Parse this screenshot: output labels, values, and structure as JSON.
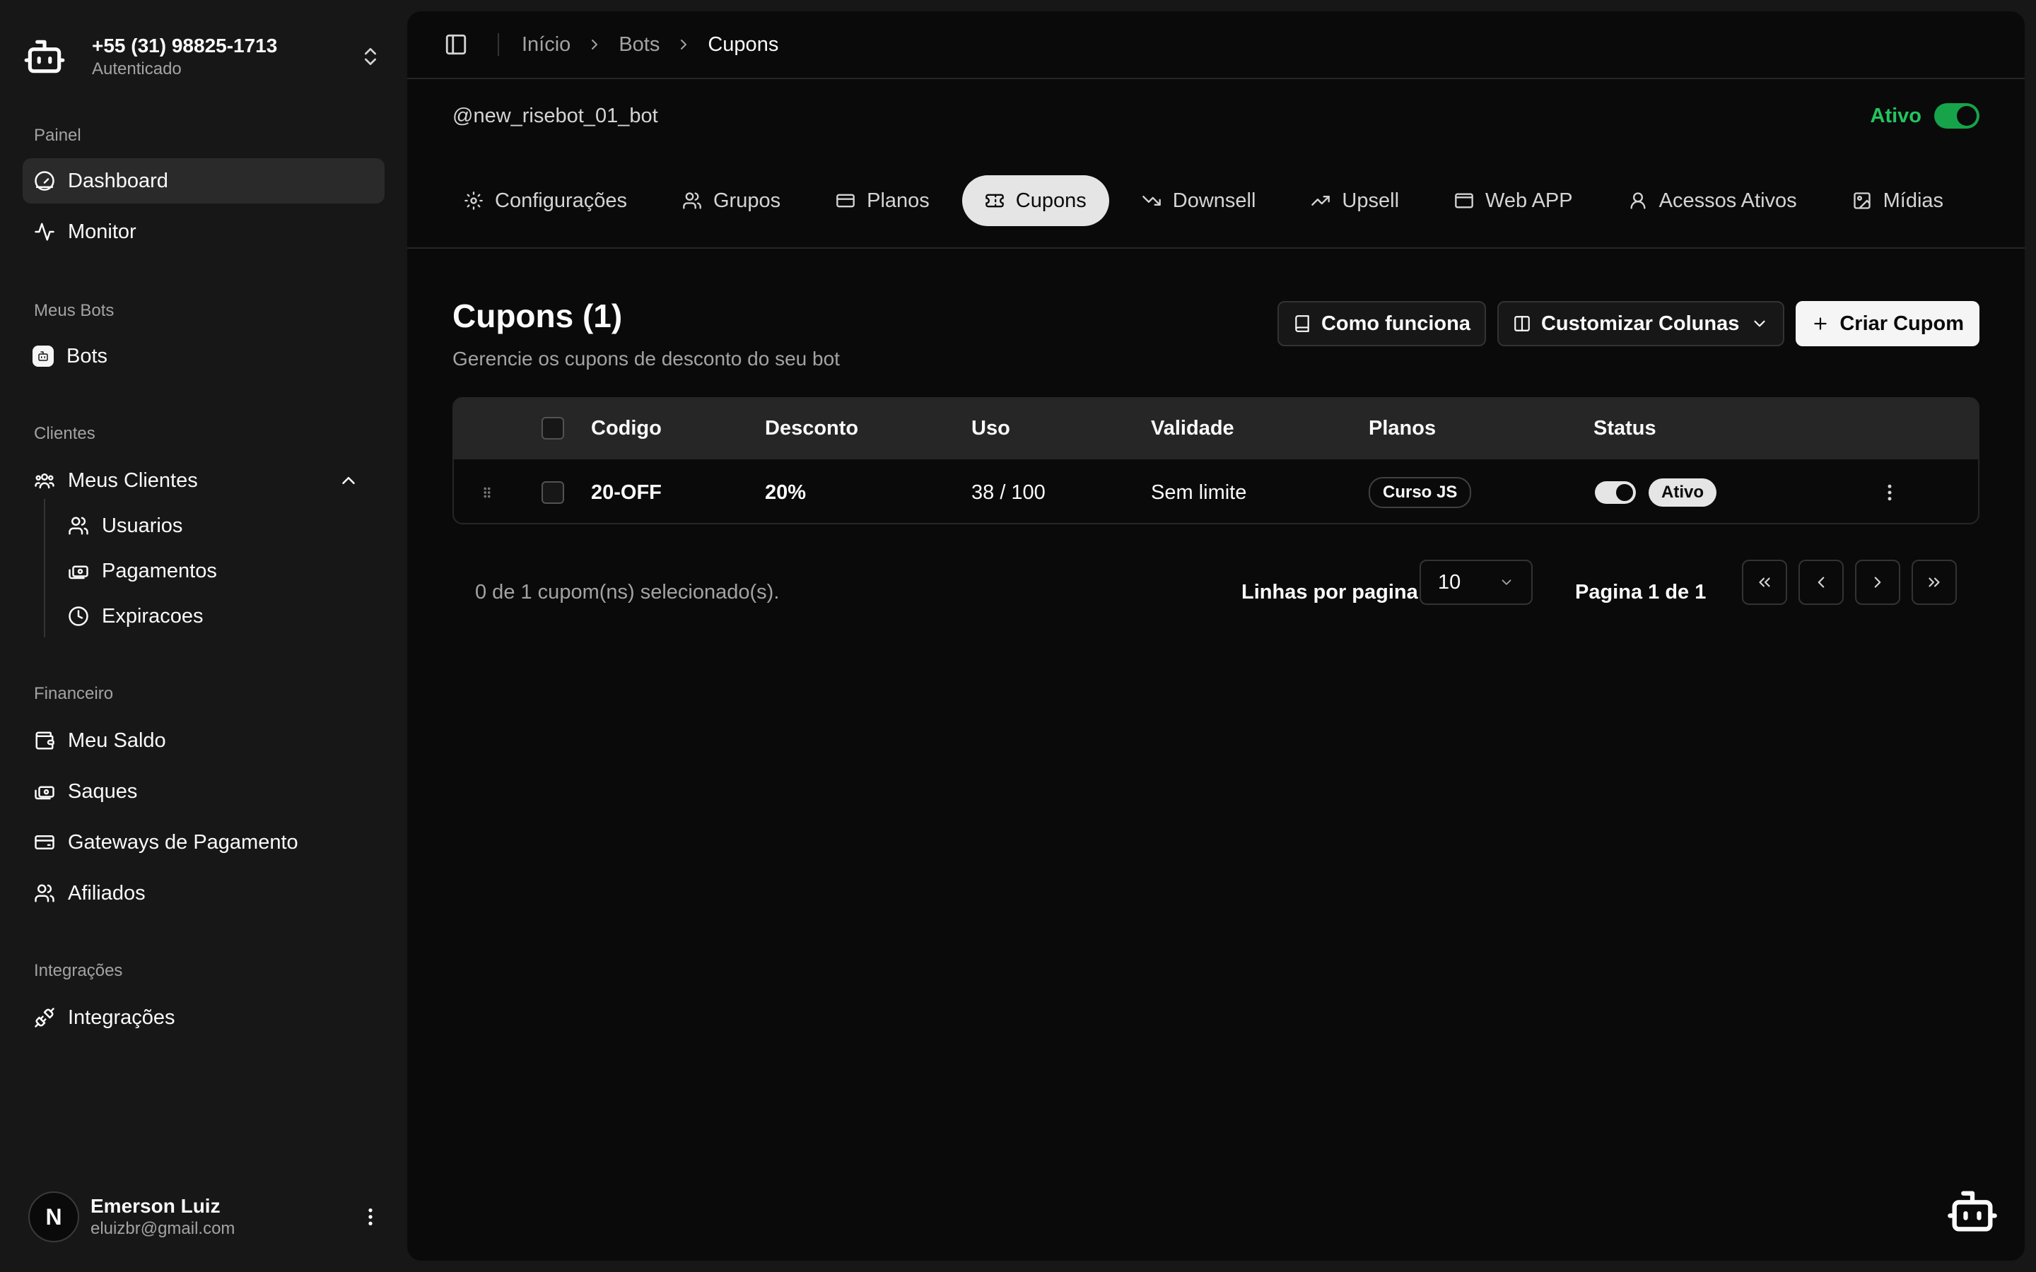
{
  "account": {
    "phone": "+55 (31) 98825-1713",
    "status": "Autenticado"
  },
  "sidebar": {
    "groups": {
      "painel": "Painel",
      "meus_bots": "Meus Bots",
      "clientes": "Clientes",
      "financeiro": "Financeiro",
      "integracoes": "Integrações"
    },
    "items": {
      "dashboard": "Dashboard",
      "monitor": "Monitor",
      "bots": "Bots",
      "meus_clientes": "Meus Clientes",
      "usuarios": "Usuarios",
      "pagamentos": "Pagamentos",
      "expiracoes": "Expiracoes",
      "meu_saldo": "Meu Saldo",
      "saques": "Saques",
      "gateways": "Gateways de Pagamento",
      "afiliados": "Afiliados",
      "integracoes": "Integrações"
    }
  },
  "user": {
    "initial": "N",
    "name": "Emerson Luiz",
    "email": "eluizbr@gmail.com"
  },
  "breadcrumb": {
    "home": "Início",
    "bots": "Bots",
    "current": "Cupons"
  },
  "bot": {
    "handle": "@new_risebot_01_bot",
    "status_label": "Ativo",
    "status_color": "#22c55e"
  },
  "tabs": {
    "configuracoes": "Configurações",
    "grupos": "Grupos",
    "planos": "Planos",
    "cupons": "Cupons",
    "downsell": "Downsell",
    "upsell": "Upsell",
    "webapp": "Web APP",
    "acessos": "Acessos Ativos",
    "midias": "Mídias"
  },
  "page": {
    "title": "Cupons (1)",
    "subtitle": "Gerencie os cupons de desconto do seu bot"
  },
  "actions": {
    "how": "Como funciona",
    "columns": "Customizar Colunas",
    "create": "Criar Cupom"
  },
  "table": {
    "headers": {
      "code": "Codigo",
      "discount": "Desconto",
      "usage": "Uso",
      "validity": "Validade",
      "plans": "Planos",
      "status": "Status"
    },
    "rows": [
      {
        "code": "20-OFF",
        "discount": "20%",
        "usage": "38 / 100",
        "validity": "Sem limite",
        "plan": "Curso JS",
        "status": "Ativo"
      }
    ]
  },
  "footer": {
    "selected": "0 de 1 cupom(ns) selecionado(s).",
    "rows_label": "Linhas por pagina",
    "rows_value": "10",
    "page_info": "Pagina 1 de 1"
  }
}
